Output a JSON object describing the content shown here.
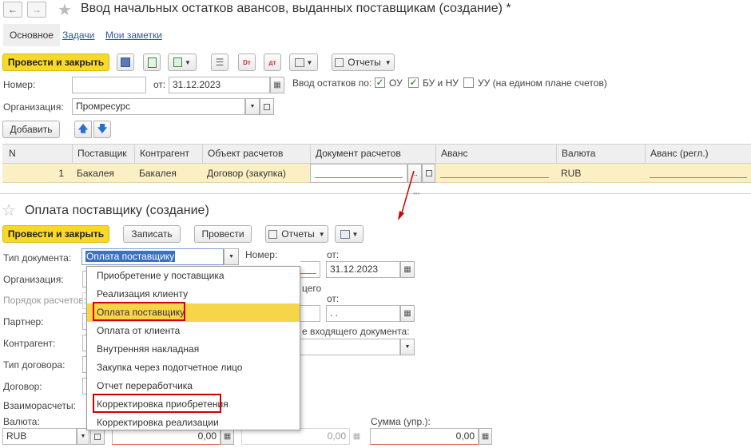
{
  "window": {
    "title": "Ввод начальных остатков авансов, выданных поставщикам (создание) *",
    "tabs": [
      "Основное",
      "Задачи",
      "Мои заметки"
    ]
  },
  "toolbar": {
    "post_close": "Провести и закрыть",
    "reports": "Отчеты"
  },
  "header_form": {
    "number_label": "Номер:",
    "number_value": "",
    "from_label": "от:",
    "date_value": "31.12.2023",
    "input_mode_label": "Ввод остатков по:",
    "ou_label": "ОУ",
    "ou_checked": true,
    "bu_label": "БУ и НУ",
    "bu_checked": true,
    "uu_label": "УУ (на едином плане счетов)",
    "uu_checked": false,
    "org_label": "Организация:",
    "org_value": "Промресурс",
    "add_button": "Добавить"
  },
  "table": {
    "columns": [
      "N",
      "Поставщик",
      "Контрагент",
      "Объект расчетов",
      "Документ расчетов",
      "Аванс",
      "Валюта",
      "Аванс (регл.)"
    ],
    "rows": [
      {
        "n": "1",
        "supplier": "Бакалея",
        "counterparty": "Бакалея",
        "object": "Договор (закупка)",
        "doc": "",
        "advance": "",
        "currency": "RUB",
        "advance_regl": ""
      }
    ],
    "more_glyph": "..."
  },
  "payment_form": {
    "title": "Оплата поставщику (создание)",
    "post_close": "Провести и закрыть",
    "write": "Записать",
    "post": "Провести",
    "reports": "Отчеты",
    "doc_type_label": "Тип документа:",
    "doc_type_value": "Оплата поставщику",
    "number_label": "Номер:",
    "from_label": "от:",
    "date_value": "31.12.2023",
    "org_label": "Организация:",
    "order_label": "Порядок расчетов:",
    "partner_label": "Партнер:",
    "counterparty_label": "Контрагент:",
    "contract_type_label": "Тип договора:",
    "contract_label": "Договор:",
    "settlements_label": "Взаиморасчеты:",
    "currency_label": "Валюта:",
    "currency_value": "RUB",
    "amount_value": "0,00",
    "amount2_value": "0,00",
    "sum_upr_label": "Сумма (упр.):",
    "sum_upr_value": "0,00",
    "incoming_partial1": "цего",
    "from2_label": "от:",
    "date2_value": " .  .",
    "incoming_doc_label": "е входящего документа:"
  },
  "dropdown": {
    "items": [
      "Приобретение у поставщика",
      "Реализация клиенту",
      "Оплата поставщику",
      "Оплата от клиента",
      "Внутренняя накладная",
      "Закупка через подотчетное лицо",
      "Отчет переработчика",
      "Корректировка приобретения",
      "Корректировка реализации"
    ],
    "selected_index": 2,
    "highlighted_indices": [
      2,
      7
    ]
  },
  "colors": {
    "accent_yellow": "#f8d829",
    "highlight_red": "#d00000",
    "link_blue": "#2f56a0",
    "row_selected": "#fbf0c4"
  }
}
